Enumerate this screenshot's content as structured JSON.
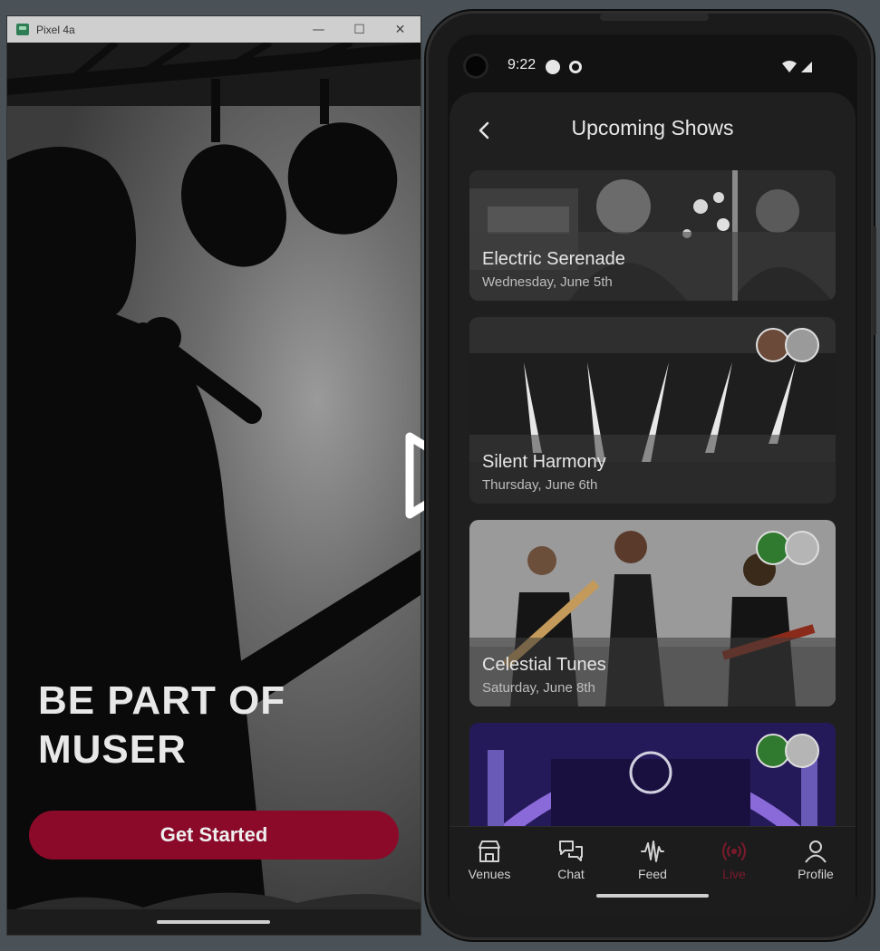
{
  "emulator": {
    "title": "Pixel 4a",
    "controls": {
      "minimize": "—",
      "maximize": "☐",
      "close": "✕"
    },
    "hero_text_line1": "BE PART OF",
    "hero_text_line2": "MUSER",
    "cta_label": "Get Started"
  },
  "phone": {
    "status": {
      "time": "9:22"
    },
    "header": {
      "title": "Upcoming Shows"
    },
    "shows": [
      {
        "name": "Electric Serenade",
        "date": "Wednesday, June 5th"
      },
      {
        "name": "Silent Harmony",
        "date": "Thursday, June 6th"
      },
      {
        "name": "Celestial Tunes",
        "date": "Saturday, June 8th"
      },
      {
        "name": "",
        "date": ""
      }
    ],
    "nav": [
      {
        "label": "Venues",
        "icon": "store-icon"
      },
      {
        "label": "Chat",
        "icon": "chat-icon"
      },
      {
        "label": "Feed",
        "icon": "waveform-icon"
      },
      {
        "label": "Live",
        "icon": "broadcast-icon",
        "active": true
      },
      {
        "label": "Profile",
        "icon": "person-icon"
      }
    ]
  },
  "colors": {
    "accent": "#8b0a2a",
    "active_nav": "#7c1a2d",
    "background": "#4a5257"
  }
}
